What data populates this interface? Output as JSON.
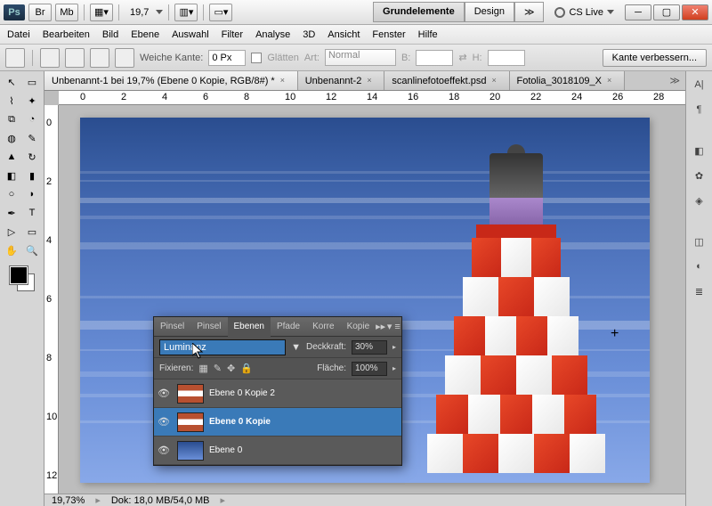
{
  "titlebar": {
    "zoom": "19,7",
    "ws_active": "Grundelemente",
    "ws_other": "Design",
    "cslive": "CS Live"
  },
  "menu": [
    "Datei",
    "Bearbeiten",
    "Bild",
    "Ebene",
    "Auswahl",
    "Filter",
    "Analyse",
    "3D",
    "Ansicht",
    "Fenster",
    "Hilfe"
  ],
  "options": {
    "weiche_label": "Weiche Kante:",
    "weiche_val": "0 Px",
    "glatten": "Glätten",
    "art": "Art:",
    "art_val": "Normal",
    "b": "B:",
    "h": "H:",
    "refine": "Kante verbessern..."
  },
  "tabs": [
    {
      "label": "Unbenannt-1 bei 19,7% (Ebene 0 Kopie, RGB/8#) *",
      "active": true
    },
    {
      "label": "Unbenannt-2",
      "active": false
    },
    {
      "label": "scanlinefotoeffekt.psd",
      "active": false
    },
    {
      "label": "Fotolia_3018109_X ",
      "active": false
    }
  ],
  "ruler_h": [
    "0",
    "2",
    "4",
    "6",
    "8",
    "10",
    "12",
    "14",
    "16",
    "18",
    "20",
    "22",
    "24",
    "26",
    "28"
  ],
  "ruler_v": [
    "0",
    "2",
    "4",
    "6",
    "8",
    "10",
    "12"
  ],
  "status": {
    "zoom": "19,73%",
    "doc": "Dok: 18,0 MB/54,0 MB"
  },
  "layers": {
    "tabs": [
      "Pinsel",
      "Pinsel",
      "Ebenen",
      "Pfade",
      "Korre",
      "Kopie"
    ],
    "active_tab": 2,
    "blend": "Luminanz",
    "opacity_label": "Deckkraft:",
    "opacity_val": "30%",
    "lock_label": "Fixieren:",
    "fill_label": "Fläche:",
    "fill_val": "100%",
    "items": [
      {
        "name": "Ebene 0 Kopie 2",
        "sel": false,
        "thumb": "stripe"
      },
      {
        "name": "Ebene 0 Kopie",
        "sel": true,
        "thumb": "stripe"
      },
      {
        "name": "Ebene 0",
        "sel": false,
        "thumb": "img"
      }
    ]
  }
}
